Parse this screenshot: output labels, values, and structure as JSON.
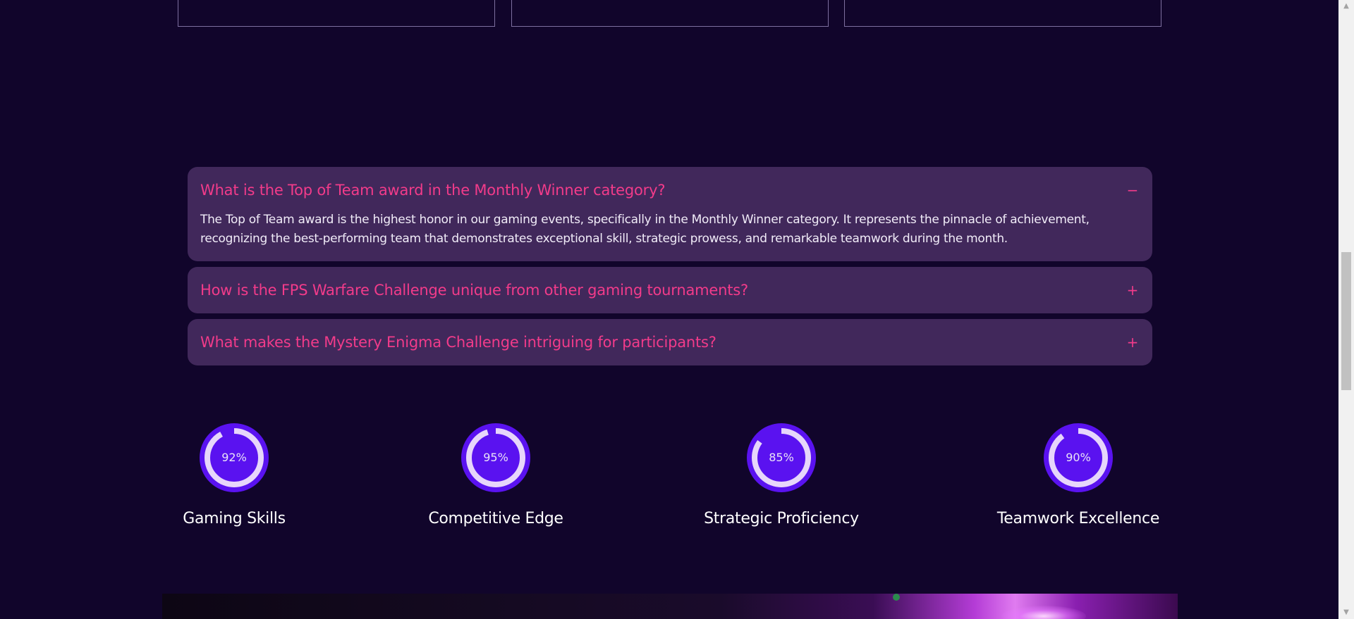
{
  "faq": [
    {
      "question": "What is the Top of Team award in the Monthly Winner category?",
      "answer": "The Top of Team award is the highest honor in our gaming events, specifically in the Monthly Winner category. It represents the pinnacle of achievement, recognizing the best-performing team that demonstrates exceptional skill, strategic prowess, and remarkable teamwork during the month.",
      "toggle": "−",
      "open": true
    },
    {
      "question": "How is the FPS Warfare Challenge unique from other gaming tournaments?",
      "toggle": "+",
      "open": false
    },
    {
      "question": "What makes the Mystery Enigma Challenge intriguing for participants?",
      "toggle": "+",
      "open": false
    }
  ],
  "skills": [
    {
      "label": "Gaming Skills",
      "value_text": "92%",
      "value": 92
    },
    {
      "label": "Competitive Edge",
      "value_text": "95%",
      "value": 95
    },
    {
      "label": "Strategic Proficiency",
      "value_text": "85%",
      "value": 85
    },
    {
      "label": "Teamwork Excellence",
      "value_text": "90%",
      "value": 90
    }
  ],
  "colors": {
    "background": "#11052b",
    "accordion_bg": "#41285b",
    "accent_pink": "#f23b8a",
    "ring_fill": "#5a12f0",
    "ring_track": "#e7d6fb"
  }
}
